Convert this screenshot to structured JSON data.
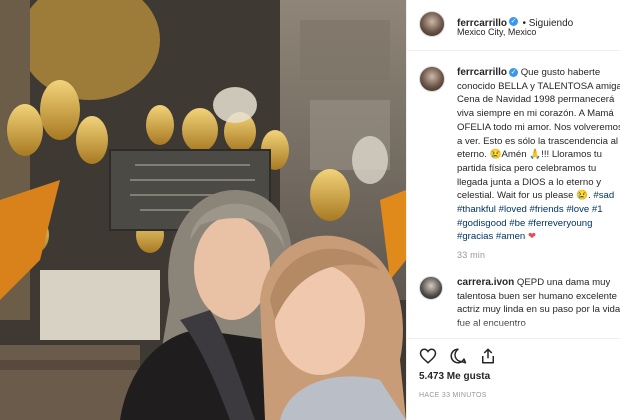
{
  "post": {
    "username": "ferrcarrillo",
    "follow_status": "• Siguiendo",
    "location": "Mexico City, Mexico",
    "caption_main": " Que gusto haberte conocido BELLA y TALENTOSA amiga. Cena de Navidad 1998 permanecerá viva siempre en mi corazón. A Mamá OFELIA todo mi amor. Nos volveremos a ver. Esto es sólo la trascendencia al eterno. 😢Amén 🙏!!! Lloramos tu partida física pero celebramos tu llegada junta a DIOS a lo eterno y celestial. Wait for us please 😢.",
    "hashtags": "#sad #thankful #loved #friends #love #1 #godisgood #be #ferreveryoung #gracias #amen",
    "heart": "❤",
    "time": "33 min"
  },
  "comments": [
    {
      "username": "carrera.ivon",
      "text": " QEPD una dama muy talentosa buen ser humano excelente actriz muy linda en su paso por la vida fue al encuentro"
    }
  ],
  "footer": {
    "likes": "5.473 Me gusta",
    "posted_ago": "HACE 33 MINUTOS"
  },
  "icons": [
    "heart-icon",
    "comment-icon",
    "share-icon",
    "verified-badge-icon"
  ],
  "colors": {
    "link": "#003569",
    "verified": "#3897f0",
    "heart": "#ed4956"
  }
}
